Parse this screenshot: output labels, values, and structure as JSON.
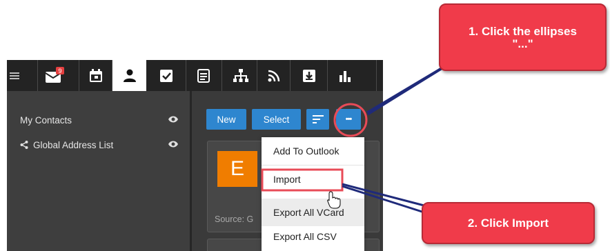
{
  "toolbar": {
    "mail_badge": "9",
    "nav": [
      {
        "name": "menu",
        "icon": "hamburger-icon"
      },
      {
        "name": "mail",
        "icon": "mail-icon"
      },
      {
        "name": "calendar",
        "icon": "calendar-icon"
      },
      {
        "name": "contacts",
        "icon": "person-icon",
        "active": true
      },
      {
        "name": "tasks",
        "icon": "checkbox-icon"
      },
      {
        "name": "notes",
        "icon": "notes-icon"
      },
      {
        "name": "org",
        "icon": "sitemap-icon"
      },
      {
        "name": "rss",
        "icon": "rss-icon"
      },
      {
        "name": "download",
        "icon": "download-box-icon"
      },
      {
        "name": "reports",
        "icon": "bar-chart-icon"
      }
    ]
  },
  "sidebar": {
    "items": [
      {
        "label": "My Contacts",
        "icon": "eye-icon"
      },
      {
        "label": "Global Address List",
        "icon": "eye-icon",
        "prefix_icon": "share-icon"
      }
    ]
  },
  "actions": {
    "new_label": "New",
    "select_label": "Select",
    "sort_icon": "sort-icon",
    "more_label": "•••"
  },
  "card": {
    "initial": "E",
    "source": "Source: G"
  },
  "menu": {
    "items": [
      "Add To Outlook",
      "Import",
      "Export All VCard",
      "Export All CSV"
    ],
    "hovered": "Export All VCard"
  },
  "annotations": {
    "callout1_line1": "1. Click the ellipses",
    "callout1_line2": "\"...\"",
    "callout2": "2. Click Import"
  },
  "colors": {
    "accent": "#2e86cf",
    "callout": "#f03b4a",
    "highlight": "#e84b57",
    "avatar": "#f07d00"
  }
}
